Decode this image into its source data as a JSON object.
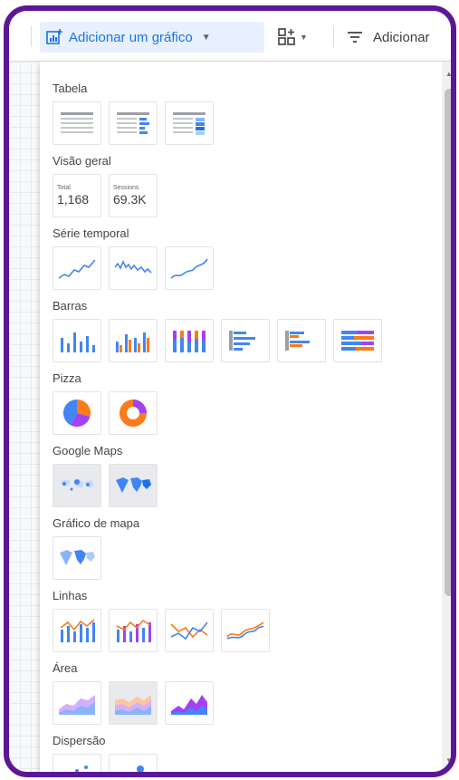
{
  "toolbar": {
    "add_chart_label": "Adicionar um gráfico",
    "add_control_icon": "add-control-icon",
    "add_filter_label": "Adicionar"
  },
  "menu": {
    "sections": [
      {
        "key": "tabela",
        "title": "Tabela"
      },
      {
        "key": "visao_geral",
        "title": "Visão geral",
        "scorecards": [
          {
            "label": "Total",
            "value": "1,168"
          },
          {
            "label": "Sessions",
            "value": "69.3K"
          }
        ]
      },
      {
        "key": "serie_temporal",
        "title": "Série temporal"
      },
      {
        "key": "barras",
        "title": "Barras"
      },
      {
        "key": "pizza",
        "title": "Pizza"
      },
      {
        "key": "google_maps",
        "title": "Google Maps"
      },
      {
        "key": "grafico_mapa",
        "title": "Gráfico de mapa"
      },
      {
        "key": "linhas",
        "title": "Linhas"
      },
      {
        "key": "area",
        "title": "Área"
      },
      {
        "key": "dispersao",
        "title": "Dispersão"
      }
    ]
  },
  "colors": {
    "frame": "#5b1796",
    "accent_blue": "#1a73e8",
    "chart_blue": "#4285f4",
    "chart_orange": "#fa7b17",
    "chart_purple": "#a142f4"
  }
}
